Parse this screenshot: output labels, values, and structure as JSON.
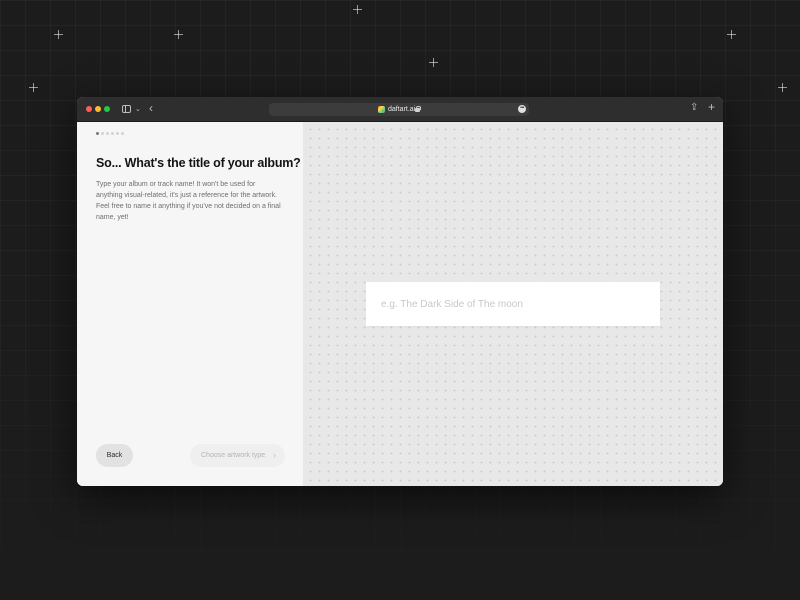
{
  "browser": {
    "url": "daftart.ai",
    "more_label": "•••",
    "share_glyph": "⇪",
    "new_tab_glyph": "+"
  },
  "wizard": {
    "total_steps": 6,
    "current_step": 1,
    "title": "So... What's the title of your album?",
    "description": "Type your album or track name! It won't be used for anything visual-related, it's just a reference for the artwork. Feel free to name it anything if you've not decided on a final name, yet!",
    "back_label": "Back",
    "next_label": "Choose artwork type",
    "next_arrow": "›"
  },
  "input": {
    "value": "",
    "placeholder": "e.g. The Dark Side of The moon"
  },
  "colors": {
    "background": "#1c1c1c",
    "panel_left": "#f6f6f6",
    "panel_right": "#e8e8e8",
    "titlebar": "#2e2e2e"
  }
}
